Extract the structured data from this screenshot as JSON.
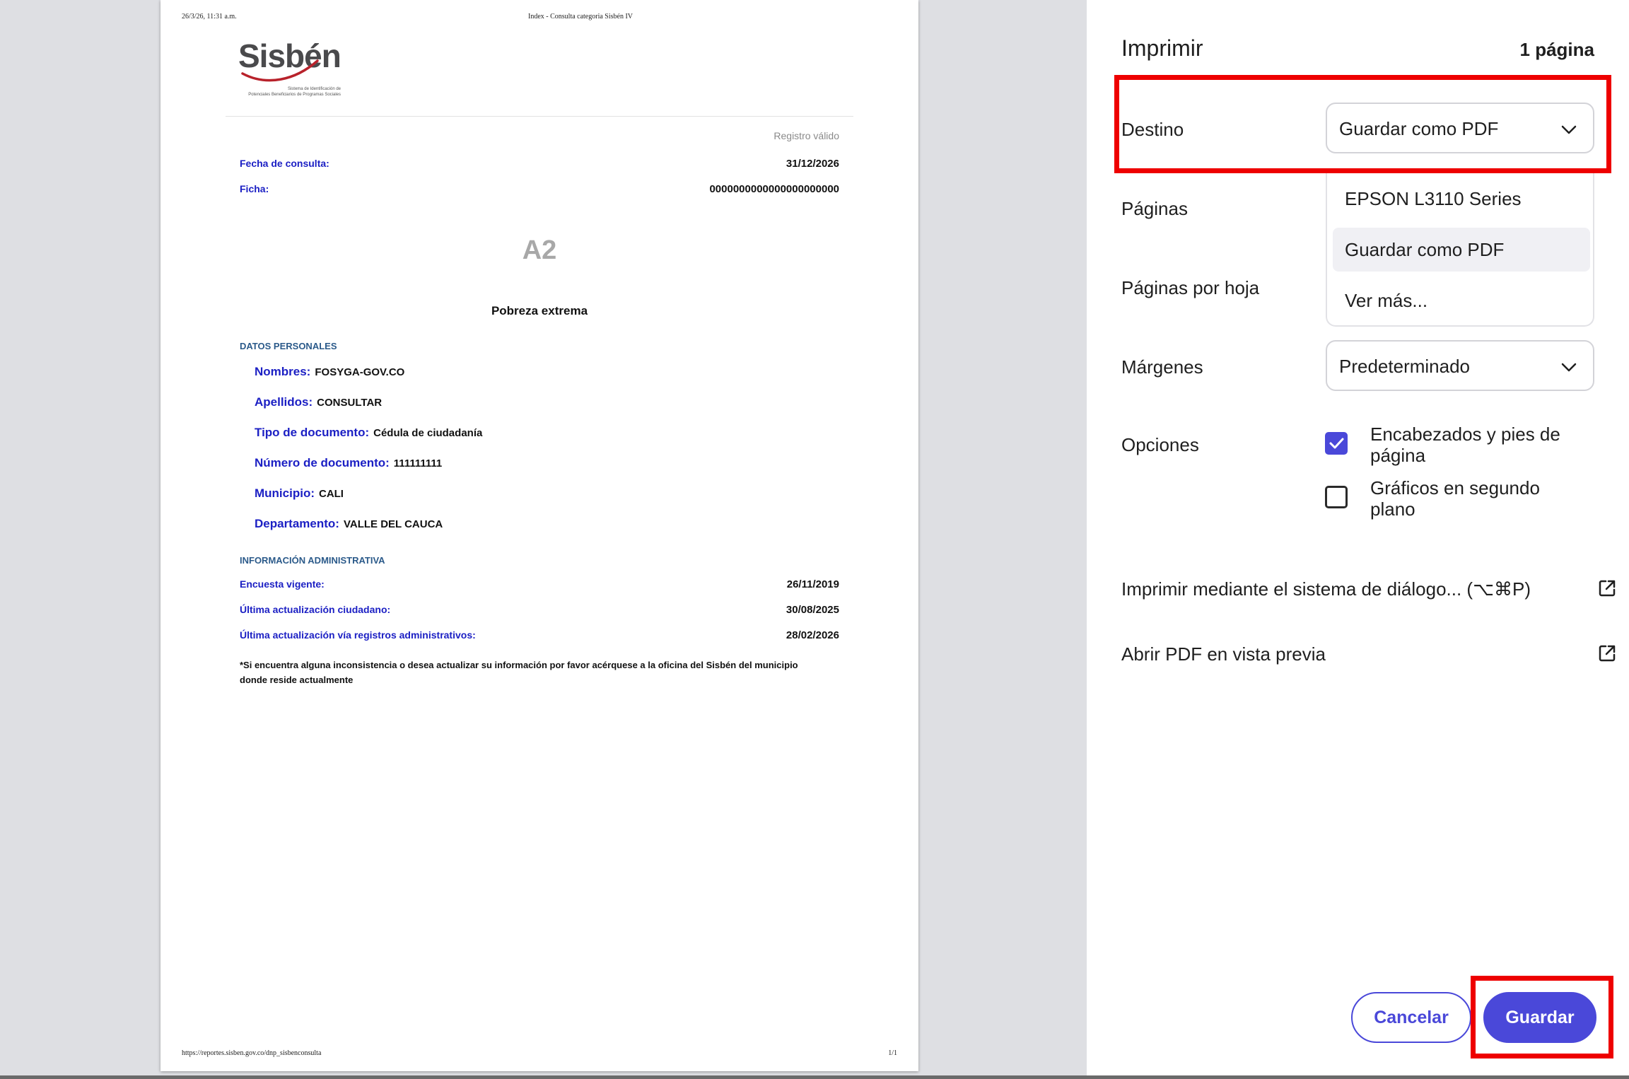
{
  "document": {
    "header_left": "26/3/26, 11:31 a.m.",
    "header_center": "Index - Consulta categoria Sisbén IV",
    "footer_left": "https://reportes.sisben.gov.co/dnp_sisbenconsulta",
    "footer_right": "1/1",
    "logo": {
      "text": "Sisbén",
      "subtitle_line1": "Sistema de Identificación de",
      "subtitle_line2": "Potenciales Beneficiarios de Programas Sociales"
    },
    "status": "Registro válido",
    "fecha_label": "Fecha de consulta:",
    "fecha_value": "31/12/2026",
    "ficha_label": "Ficha:",
    "ficha_value": "0000000000000000000000",
    "category": "A2",
    "category_desc": "Pobreza extrema",
    "personal_section": "DATOS PERSONALES",
    "personal": [
      {
        "label": "Nombres:",
        "value": "FOSYGA-GOV.CO"
      },
      {
        "label": "Apellidos:",
        "value": "CONSULTAR"
      },
      {
        "label": "Tipo de documento:",
        "value": "Cédula de ciudadanía"
      },
      {
        "label": "Número de documento:",
        "value": "111111111"
      },
      {
        "label": "Municipio:",
        "value": "CALI"
      },
      {
        "label": "Departamento:",
        "value": "VALLE DEL CAUCA"
      }
    ],
    "admin_section": "INFORMACIÓN ADMINISTRATIVA",
    "admin": [
      {
        "label": "Encuesta vigente:",
        "value": "26/11/2019"
      },
      {
        "label": "Última actualización ciudadano:",
        "value": "30/08/2025"
      },
      {
        "label": "Última actualización vía registros administrativos:",
        "value": "28/02/2026"
      }
    ],
    "note_line1": "*Si encuentra alguna inconsistencia o desea actualizar su información por favor acérquese a la oficina del Sisbén del municipio",
    "note_line2": "donde reside actualmente"
  },
  "print_panel": {
    "title": "Imprimir",
    "page_count": "1 página",
    "destino_label": "Destino",
    "destino_value": "Guardar como PDF",
    "destino_options": [
      "EPSON L3110 Series",
      "Guardar como PDF",
      "Ver más..."
    ],
    "paginas_label": "Páginas",
    "paginas_por_hoja_label": "Páginas por hoja",
    "margenes_label": "Márgenes",
    "margenes_value": "Predeterminado",
    "opciones_label": "Opciones",
    "option_headers_line1": "Encabezados y pies de",
    "option_headers_line2": "página",
    "option_headers_checked": true,
    "option_graphics_line1": "Gráficos en segundo",
    "option_graphics_line2": "plano",
    "option_graphics_checked": false,
    "system_dialog_link": "Imprimir mediante el sistema de diálogo... (⌥⌘P)",
    "open_pdf_link": "Abrir PDF en vista previa",
    "cancel_label": "Cancelar",
    "save_label": "Guardar"
  },
  "colors": {
    "accent": "#4a48d9",
    "doc_label_blue": "#1c20c4",
    "highlight_red": "#ee0000",
    "logo_red": "#b8222b"
  }
}
